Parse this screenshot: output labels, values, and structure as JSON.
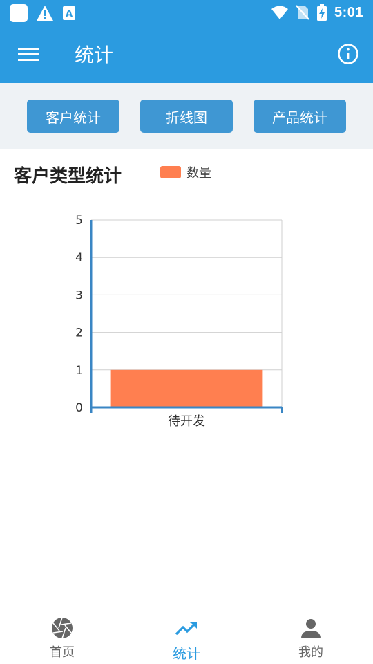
{
  "status_bar": {
    "time": "5:01"
  },
  "app_bar": {
    "title": "统计"
  },
  "tabs": [
    {
      "label": "客户统计"
    },
    {
      "label": "折线图"
    },
    {
      "label": "产品统计"
    }
  ],
  "chart_data": {
    "type": "bar",
    "title": "客户类型统计",
    "categories": [
      "待开发"
    ],
    "series": [
      {
        "name": "数量",
        "values": [
          1
        ],
        "color": "#ff7f50"
      }
    ],
    "ylim": [
      0,
      5
    ],
    "yticks": [
      0,
      1,
      2,
      3,
      4,
      5
    ],
    "grid": true,
    "legend": "top"
  },
  "bottom_nav": [
    {
      "label": "首页",
      "icon": "aperture-icon"
    },
    {
      "label": "统计",
      "icon": "trending-up-icon",
      "active": true
    },
    {
      "label": "我的",
      "icon": "person-icon"
    }
  ],
  "colors": {
    "primary": "#2b9be0",
    "button": "#3f97d3",
    "bar": "#ff7f50"
  }
}
